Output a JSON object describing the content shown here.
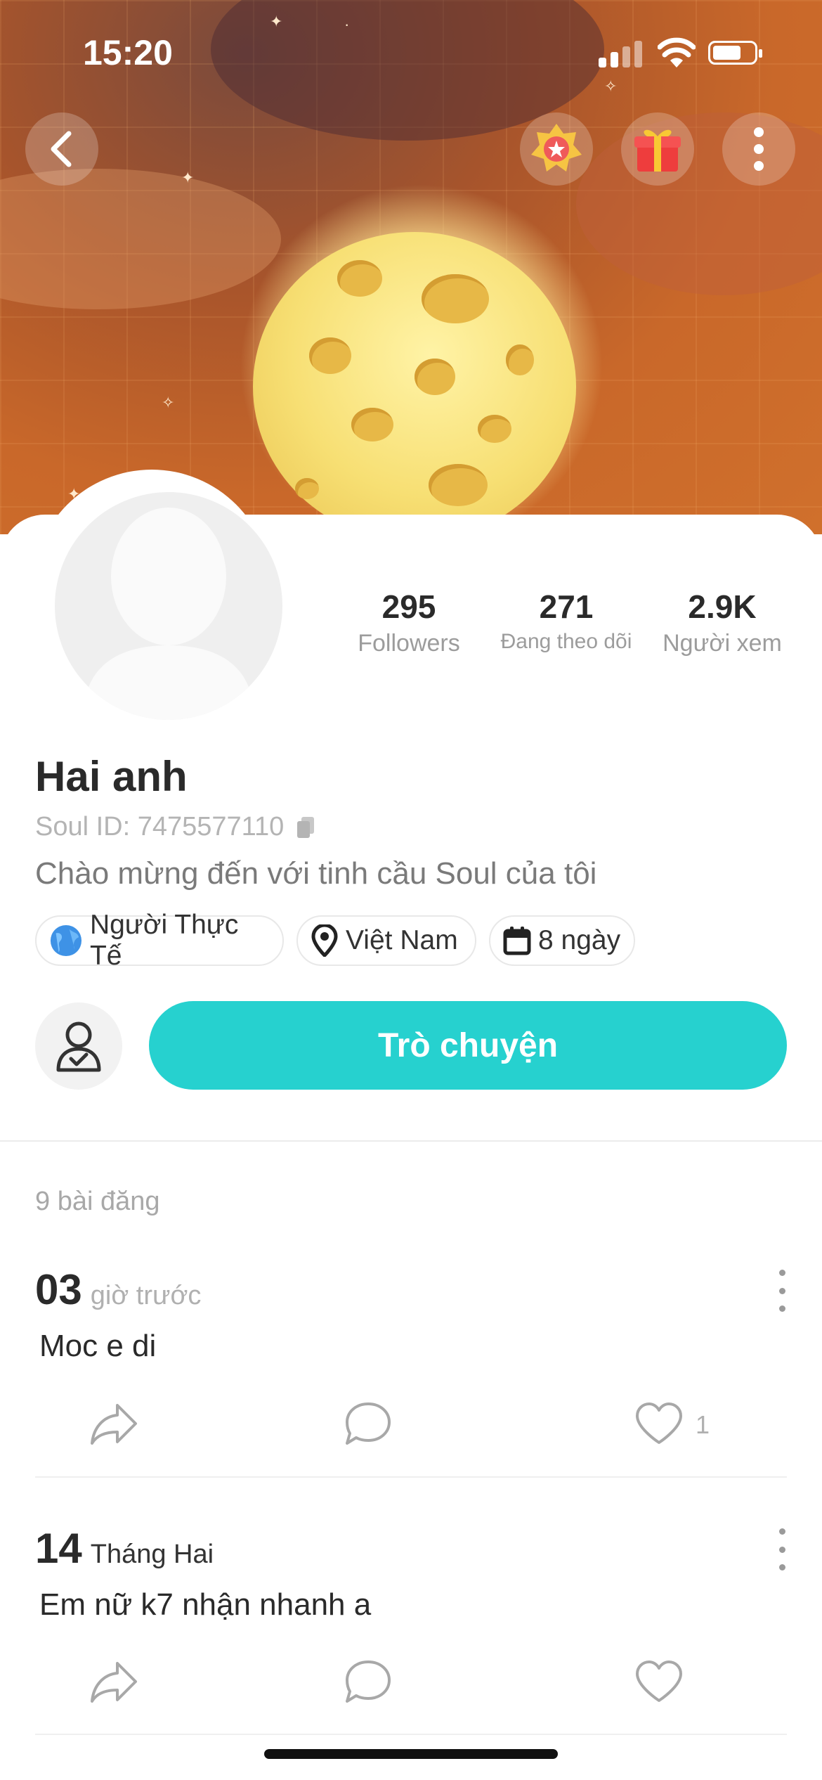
{
  "status_bar": {
    "time": "15:20"
  },
  "profile": {
    "name": "Hai anh",
    "soul_id": "Soul ID: 7475577110",
    "bio": "Chào mừng đến với tinh cầu Soul của tôi",
    "stats": [
      {
        "value": "295",
        "label": "Followers"
      },
      {
        "value": "271",
        "label": "Đang theo dõi"
      },
      {
        "value": "2.9K",
        "label": "Người xem"
      }
    ],
    "chips": {
      "real_person": "Người Thực Tế",
      "location": "Việt Nam",
      "days": "8 ngày"
    },
    "chat_button": "Trò chuyện"
  },
  "feed": {
    "post_count": "9 bài đăng",
    "posts": [
      {
        "day": "03",
        "unit": "giờ trước",
        "text": "Moc e di",
        "likes": "1"
      },
      {
        "day": "14",
        "unit": "Tháng Hai",
        "text": "Em nữ k7 nhận nhanh a",
        "likes": ""
      }
    ]
  },
  "colors": {
    "accent": "#26d1cf",
    "hero": "#c9682a"
  },
  "icons": [
    "back-icon",
    "badge-icon",
    "gift-icon",
    "more-icon",
    "globe-icon",
    "location-pin-icon",
    "calendar-icon",
    "follow-user-icon",
    "share-icon",
    "comment-icon",
    "heart-icon",
    "copy-icon"
  ]
}
